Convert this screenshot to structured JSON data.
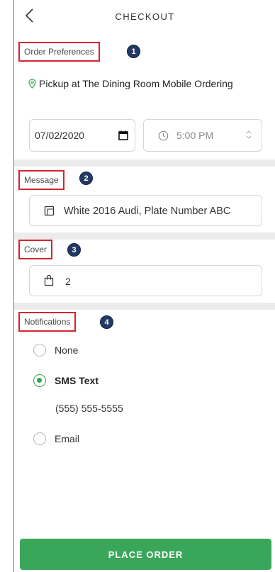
{
  "header": {
    "title": "CHECKOUT"
  },
  "order_preferences": {
    "label": "Order Preferences",
    "badge": "1",
    "pickup_text": "Pickup at The Dining Room Mobile Ordering",
    "date_value": "07/02/2020",
    "time_value": "5:00 PM"
  },
  "message": {
    "label": "Message",
    "badge": "2",
    "value": "White 2016 Audi, Plate Number ABC"
  },
  "cover": {
    "label": "Cover",
    "badge": "3",
    "value": "2"
  },
  "notifications": {
    "label": "Notifications",
    "badge": "4",
    "options": [
      {
        "label": "None",
        "selected": false
      },
      {
        "label": "SMS Text",
        "selected": true
      },
      {
        "label": "Email",
        "selected": false
      }
    ],
    "phone": "(555) 555-5555"
  },
  "footer": {
    "place_order_label": "PLACE ORDER",
    "button_color": "#3aa65a"
  },
  "colors": {
    "accent": "#2fa84f",
    "highlight_border": "#d9232e",
    "badge": "#233a66"
  }
}
